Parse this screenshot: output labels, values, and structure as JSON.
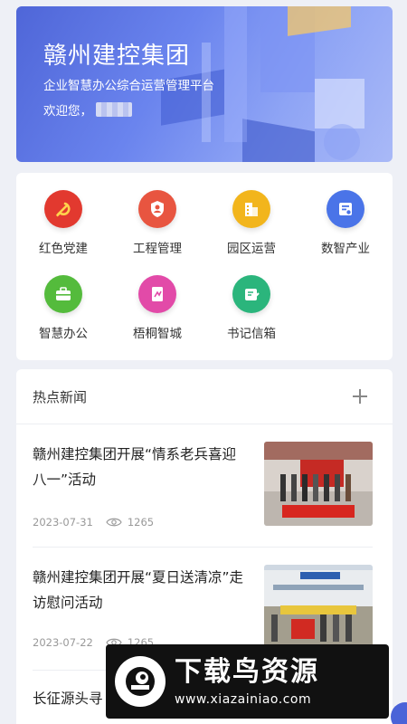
{
  "banner": {
    "title": "赣州建控集团",
    "subtitle": "企业智慧办公综合运营管理平台",
    "welcome": "欢迎您，"
  },
  "menu": [
    {
      "label": "红色党建",
      "icon": "party-emblem-icon",
      "color": "#e2392f"
    },
    {
      "label": "工程管理",
      "icon": "shield-user-icon",
      "color": "#e85540"
    },
    {
      "label": "园区运营",
      "icon": "building-icon",
      "color": "#f2b51c"
    },
    {
      "label": "数智产业",
      "icon": "data-doc-icon",
      "color": "#4a74e8"
    },
    {
      "label": "智慧办公",
      "icon": "briefcase-icon",
      "color": "#54bb3c"
    },
    {
      "label": "梧桐智城",
      "icon": "report-icon",
      "color": "#e24aa8"
    },
    {
      "label": "书记信箱",
      "icon": "mail-edit-icon",
      "color": "#2bb57c"
    }
  ],
  "news": {
    "header": "热点新闻",
    "items": [
      {
        "title": "赣州建控集团开展“情系老兵喜迎八一”活动",
        "date": "2023-07-31",
        "views": "1265"
      },
      {
        "title": "赣州建控集团开展“夏日送清凉”走访慰问活动",
        "date": "2023-07-22",
        "views": "1265"
      },
      {
        "title": "长征源头寻",
        "date": "",
        "views": ""
      }
    ]
  },
  "watermark": {
    "title": "下载鸟资源",
    "url": "www.xiazainiao.com"
  }
}
